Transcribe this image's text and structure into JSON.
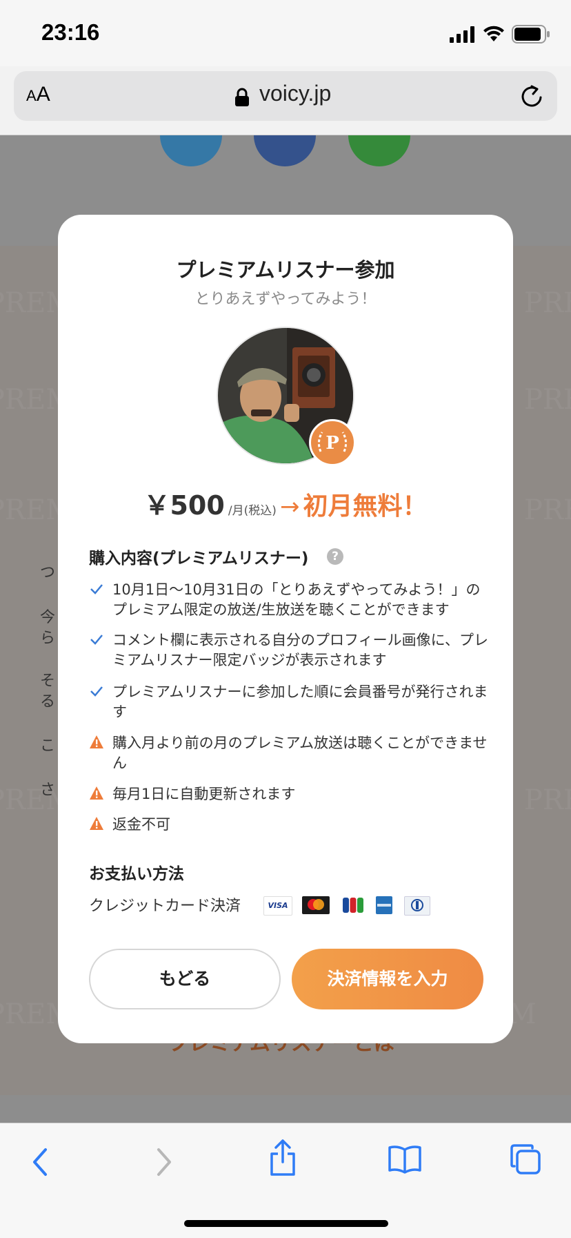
{
  "status_bar": {
    "time": "23:16"
  },
  "browser": {
    "text_size_label_small": "A",
    "text_size_label_large": "A",
    "url": "voicy.jp"
  },
  "page": {
    "watermark": "PREMIUM",
    "bg_text_fragments": [
      "つ",
      "今",
      "ら",
      "そ",
      "る",
      "こ",
      "さ"
    ],
    "bg_link_text": "プレミアムリスナーとは"
  },
  "modal": {
    "title": "プレミアムリスナー参加",
    "subtitle": "とりあえずやってみよう！",
    "badge_letter": "P",
    "price": "￥500",
    "price_unit": "/月(税込)",
    "arrow": "→",
    "free_text": "初月無料！",
    "contents_heading": "購入内容(プレミアムリスナー)",
    "help_icon": "?",
    "items": [
      {
        "type": "check",
        "text": "10月1日〜10月31日の「とりあえずやってみよう！」のプレミアム限定の放送/生放送を聴くことができます"
      },
      {
        "type": "check",
        "text": "コメント欄に表示される自分のプロフィール画像に、プレミアムリスナー限定バッジが表示されます"
      },
      {
        "type": "check",
        "text": "プレミアムリスナーに参加した順に会員番号が発行されます"
      },
      {
        "type": "warning",
        "text": "購入月より前の月のプレミアム放送は聴くことができません"
      },
      {
        "type": "warning",
        "text": "毎月1日に自動更新されます"
      },
      {
        "type": "warning",
        "text": "返金不可"
      }
    ],
    "payment_heading": "お支払い方法",
    "payment_method": "クレジットカード決済",
    "card_icons": [
      "visa-icon",
      "mastercard-icon",
      "jcb-icon",
      "amex-icon",
      "diners-icon"
    ],
    "visa_text": "VISA",
    "back_button": "もどる",
    "pay_button": "決済情報を入力",
    "accent_color": "#ee7c3a",
    "check_color": "#3a7bd5",
    "warning_color": "#ee7c3a"
  }
}
